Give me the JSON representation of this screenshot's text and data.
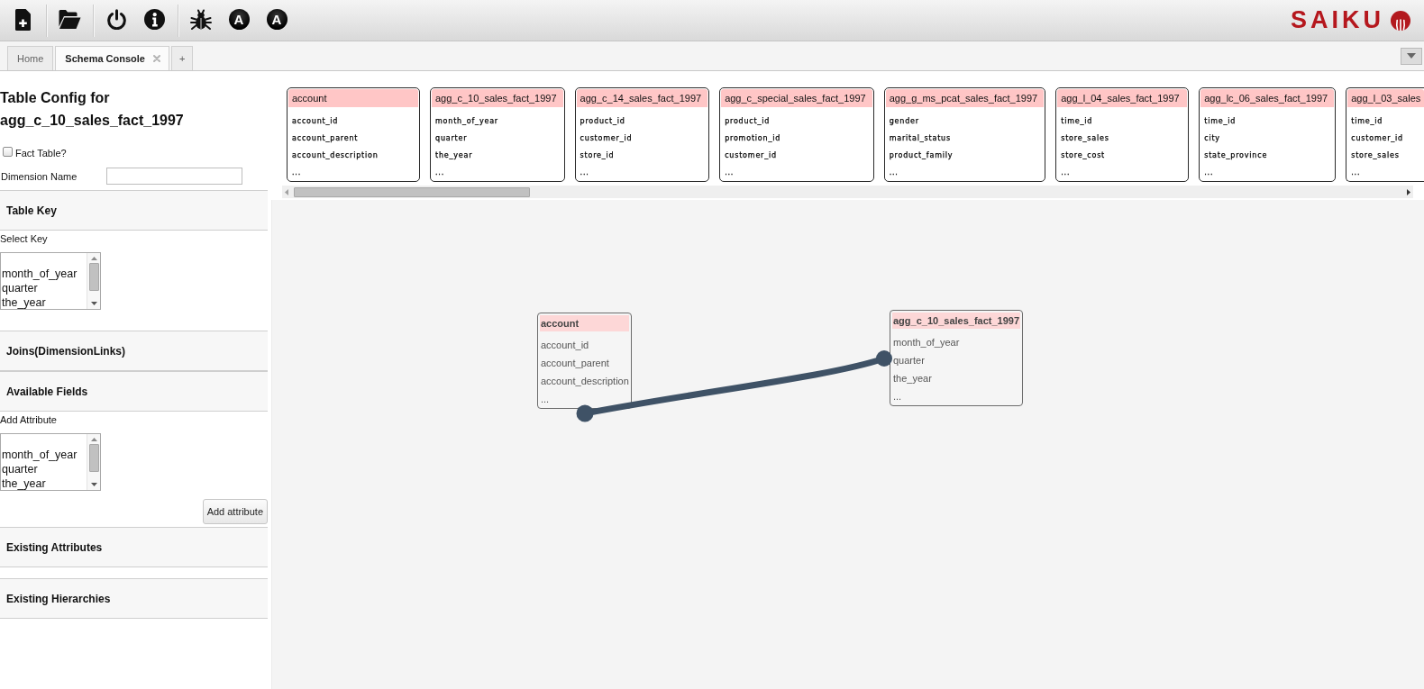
{
  "toolbar": {
    "groups": [
      [
        {
          "kind": "new-file"
        }
      ],
      [
        {
          "kind": "open-folder"
        }
      ],
      [
        {
          "kind": "power"
        },
        {
          "kind": "info"
        }
      ],
      [
        {
          "kind": "bug"
        },
        {
          "kind": "letter",
          "label": "A"
        },
        {
          "kind": "letter",
          "label": "A"
        }
      ]
    ]
  },
  "logo": {
    "text": "SAIKU"
  },
  "tabs": {
    "items": [
      {
        "label": "Home",
        "selected": false,
        "closable": false
      },
      {
        "label": "Schema Console",
        "selected": true,
        "closable": true
      }
    ],
    "add_label": "+"
  },
  "table_config": {
    "title": "Table Config for agg_c_10_sales_fact_1997",
    "fact_table": {
      "label": "Fact Table?",
      "checked": false
    },
    "dimension_name": {
      "label": "Dimension Name"
    },
    "sections": [
      {
        "title": "Table Key",
        "list": {
          "label": "Select Key",
          "options": [
            {
              "text": "month_of_year",
              "selected": false
            },
            {
              "text": "quarter",
              "selected": false
            },
            {
              "text": "the_year",
              "selected": false
            }
          ]
        }
      },
      {
        "title": "Joins(DimensionLinks)"
      },
      {
        "title": "Available Fields",
        "list": {
          "label": "Add Attribute",
          "options": [
            {
              "text": "month_of_year",
              "selected": false
            },
            {
              "text": "quarter",
              "selected": false
            },
            {
              "text": "the_year",
              "selected": false
            }
          ]
        },
        "button": "Add attribute"
      },
      {
        "title": "Existing Attributes"
      },
      {
        "title": "Existing Hierarchies"
      }
    ]
  },
  "table_strip": {
    "tables": [
      {
        "name": "account",
        "fields": [
          "account_id",
          "account_parent",
          "account_description",
          "..."
        ]
      },
      {
        "name": "agg_c_10_sales_fact_1997",
        "fields": [
          "month_of_year",
          "quarter",
          "the_year",
          "..."
        ]
      },
      {
        "name": "agg_c_14_sales_fact_1997",
        "fields": [
          "product_id",
          "customer_id",
          "store_id",
          "..."
        ]
      },
      {
        "name": "agg_c_special_sales_fact_1997",
        "fields": [
          "product_id",
          "promotion_id",
          "customer_id",
          "..."
        ]
      },
      {
        "name": "agg_g_ms_pcat_sales_fact_1997",
        "fields": [
          "gender",
          "marital_status",
          "product_family",
          "..."
        ]
      },
      {
        "name": "agg_l_04_sales_fact_1997",
        "fields": [
          "time_id",
          "store_sales",
          "store_cost",
          "..."
        ]
      },
      {
        "name": "agg_lc_06_sales_fact_1997",
        "fields": [
          "time_id",
          "city",
          "state_province",
          "..."
        ]
      },
      {
        "name": "agg_l_03_sales",
        "fields": [
          "time_id",
          "customer_id",
          "store_sales",
          "..."
        ]
      }
    ]
  },
  "canvas": {
    "nodes": [
      {
        "name": "account",
        "fields": [
          "account_id",
          "account_parent",
          "account_description",
          "..."
        ]
      },
      {
        "name": "agg_c_10_sales_fact_1997",
        "fields": [
          "month_of_year",
          "quarter",
          "the_year",
          "..."
        ]
      }
    ],
    "joined": true
  }
}
